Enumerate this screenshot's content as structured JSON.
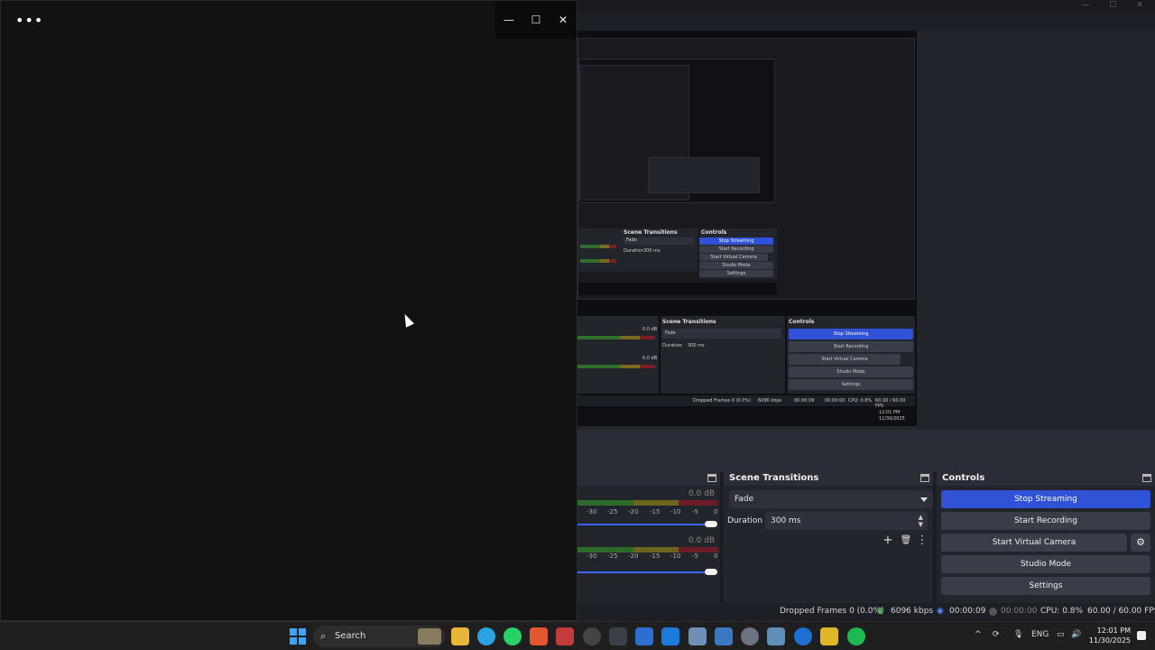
{
  "black_window": {
    "menu_label": "•••",
    "minimize": "—",
    "maximize": "☐",
    "close": "✕"
  },
  "obs": {
    "window_controls": [
      "—",
      "☐",
      "✕"
    ],
    "mixer": {
      "channels": [
        {
          "db": "0.0 dB",
          "ticks": [
            "-30",
            "-25",
            "-20",
            "-15",
            "-10",
            "-5",
            "0"
          ]
        },
        {
          "db": "0.0 dB",
          "ticks": [
            "-30",
            "-25",
            "-20",
            "-15",
            "-10",
            "-5",
            "0"
          ]
        }
      ]
    },
    "scene_transitions": {
      "title": "Scene Transitions",
      "transition": "Fade",
      "duration_label": "Duration",
      "duration_value": "300 ms",
      "add": "+",
      "remove": "🗑",
      "more": "⋮"
    },
    "controls": {
      "title": "Controls",
      "stop_streaming": "Stop Streaming",
      "start_recording": "Start Recording",
      "start_virtual_camera": "Start Virtual Camera",
      "studio_mode": "Studio Mode",
      "settings": "Settings",
      "gear": "⚙"
    },
    "status": {
      "dropped_frames": "Dropped Frames 0 (0.0%)",
      "bitrate": "6096 kbps",
      "stream_time": "00:00:09",
      "record_time": "00:00:00",
      "cpu": "CPU: 0.8%",
      "fps": "60.00 / 60.00 FPS"
    },
    "nested": {
      "scene_transitions": "Scene Transitions",
      "fade": "Fade",
      "duration": "Duration",
      "duration_value": "300 ms",
      "controls": "Controls",
      "stop_streaming": "Stop Streaming",
      "start_recording": "Start Recording",
      "start_virtual_camera": "Start Virtual Camera",
      "studio_mode": "Studio Mode",
      "settings": "Settings",
      "dropped": "Dropped Frames 0 (0.0%)",
      "kbps": "6096 kbps",
      "stream": "00:00:09",
      "rec": "00:00:00",
      "cpu": "CPU: 0.8%",
      "fps": "60.00 / 60.00 FPS",
      "db": "0.0 dB",
      "time": "12:01 PM",
      "date": "11/30/2025"
    }
  },
  "taskbar": {
    "search_placeholder": "Search",
    "search_icon": "search-icon",
    "apps": [
      "file-explorer-icon",
      "telegram-icon",
      "whatsapp-icon",
      "brave-icon",
      "app-icon",
      "app-icon",
      "terminal-icon",
      "app-icon",
      "shield-icon",
      "app-icon",
      "app-icon",
      "settings-icon",
      "app-icon",
      "app-icon",
      "app-icon",
      "spotify-icon"
    ],
    "tray": {
      "chevron": "^",
      "language": "ENG",
      "time": "12:01 PM",
      "date": "11/30/2025"
    }
  },
  "colors": {
    "accent_blue": "#2f52d6",
    "windows_blue": "#3fa4f5"
  }
}
